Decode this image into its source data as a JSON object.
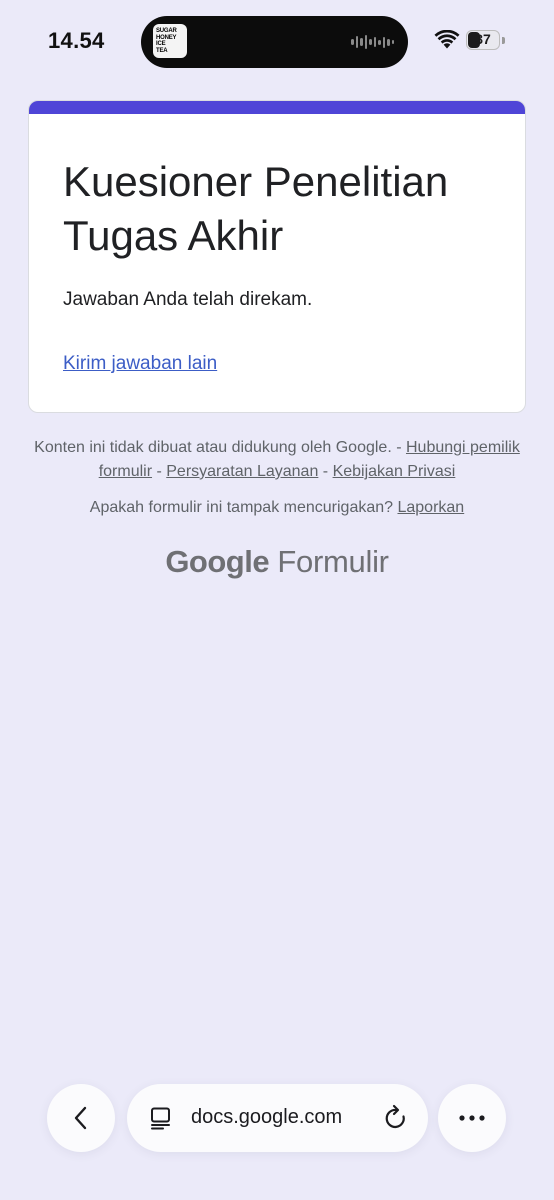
{
  "status_bar": {
    "time": "14.54",
    "island_art_lines": [
      "SUGAR",
      "HONEY",
      "ICE",
      "TEA"
    ],
    "battery_level": "37"
  },
  "form": {
    "accent_color": "#4f45d7",
    "title": "Kuesioner Penelitian Tugas Akhir",
    "confirmation": "Jawaban Anda telah direkam.",
    "another_response_link": "Kirim jawaban lain"
  },
  "footer": {
    "disclaimer_text": "Konten ini tidak dibuat atau didukung oleh Google. - ",
    "contact_owner_link": "Hubungi pemilik formulir",
    "sep1": " - ",
    "terms_link": "Persyaratan Layanan",
    "sep2": " - ",
    "privacy_link": "Kebijakan Privasi",
    "report_question": "Apakah formulir ini tampak mencurigakan? ",
    "report_link": "Laporkan",
    "brand_google": "Google",
    "brand_product": "Formulir"
  },
  "browser_bar": {
    "url": "docs.google.com",
    "back_icon": "chevron-left-icon",
    "tabs_icon": "page-menu-icon",
    "reload_icon": "reload-icon",
    "more_icon": "more-horizontal-icon"
  }
}
